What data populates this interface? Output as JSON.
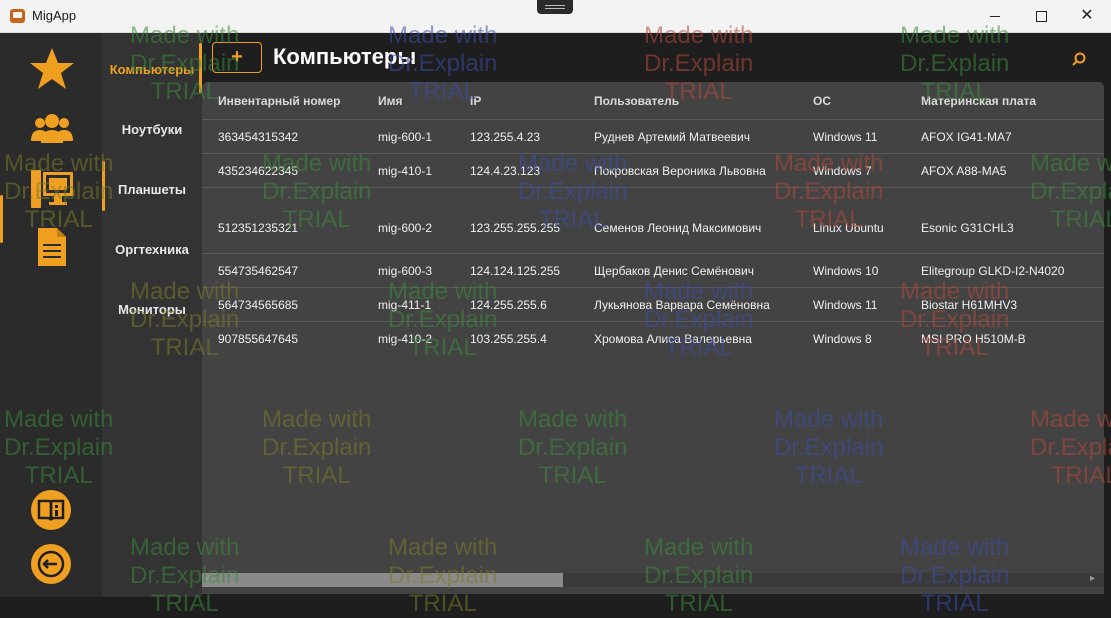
{
  "window": {
    "title": "MigApp"
  },
  "colors": {
    "accent": "#f0a020",
    "background": "#1e1e1e",
    "panel": "#434343"
  },
  "rail": {
    "icons": [
      "star-icon",
      "users-icon",
      "computer-icon",
      "document-icon"
    ],
    "bottom": [
      "manual-icon",
      "logout-icon"
    ]
  },
  "categories": [
    {
      "label": "Компьютеры",
      "active": true
    },
    {
      "label": "Ноутбуки",
      "active": false
    },
    {
      "label": "Планшеты",
      "active": false
    },
    {
      "label": "Оргтехника",
      "active": false
    },
    {
      "label": "Мониторы",
      "active": false
    }
  ],
  "header": {
    "add_label": "+",
    "title": "Компьютеры"
  },
  "table": {
    "columns": [
      "Инвентарный номер",
      "Имя",
      "IP",
      "Пользователь",
      "ОС",
      "Материнская плата"
    ],
    "rows": [
      [
        "363454315342",
        "mig-600-1",
        "123.255.4.23",
        "Руднев Артемий Матвеевич",
        "Windows 11",
        "AFOX IG41-MA7"
      ],
      [
        "435234622345",
        "mig-410-1",
        "124.4.23.123",
        "Покровская Вероника Львовна",
        "Windows 7",
        "AFOX A88-MA5"
      ],
      [
        "512351235321",
        "mig-600-2",
        "123.255.255.255",
        "Семенов Леонид Максимович",
        "Linux Ubuntu",
        "Esonic G31CHL3"
      ],
      [
        "554735462547",
        "mig-600-3",
        "124.124.125.255",
        "Щербаков Денис Семёнович",
        "Windows 10",
        "Elitegroup GLKD-I2-N4020"
      ],
      [
        "564734565685",
        "mig-411-1",
        "124.255.255.6",
        "Лукьянова Варвара Семёновна",
        "Windows 11",
        "Biostar H61MHV3"
      ],
      [
        "907855647645",
        "mig-410-2",
        "103.255.255.4",
        "Хромова Алиса Валерьевна",
        "Windows 8",
        "MSI PRO H510M-B"
      ]
    ]
  },
  "watermark": {
    "line1": "Made with",
    "line2": "Dr.Explain",
    "line3": "TRIAL"
  }
}
